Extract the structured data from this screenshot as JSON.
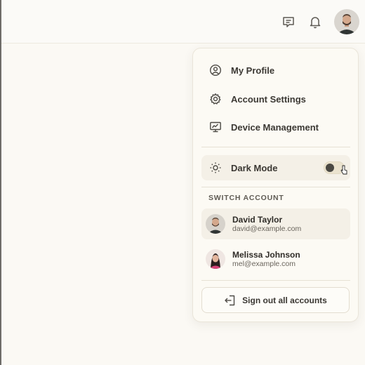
{
  "topbar": {
    "icons": [
      "message-icon",
      "bell-icon"
    ],
    "avatar": "user-avatar"
  },
  "menu": {
    "items": [
      {
        "label": "My Profile",
        "icon": "user-circle-icon"
      },
      {
        "label": "Account Settings",
        "icon": "gear-icon"
      },
      {
        "label": "Device Management",
        "icon": "monitor-icon"
      }
    ],
    "dark_mode": {
      "label": "Dark Mode",
      "icon": "sun-icon",
      "enabled": false
    },
    "switch_account_heading": "SWITCH ACCOUNT",
    "accounts": [
      {
        "name": "David Taylor",
        "email": "david@example.com",
        "active": true
      },
      {
        "name": "Melissa Johnson",
        "email": "mel@example.com",
        "active": false
      }
    ],
    "sign_out_label": "Sign out all accounts",
    "sign_out_icon": "sign-out-icon"
  },
  "colors": {
    "background": "#fbf9f4",
    "menu_bg": "#fcfaf4",
    "highlight": "#f4f0e7",
    "text": "#3b3833"
  }
}
